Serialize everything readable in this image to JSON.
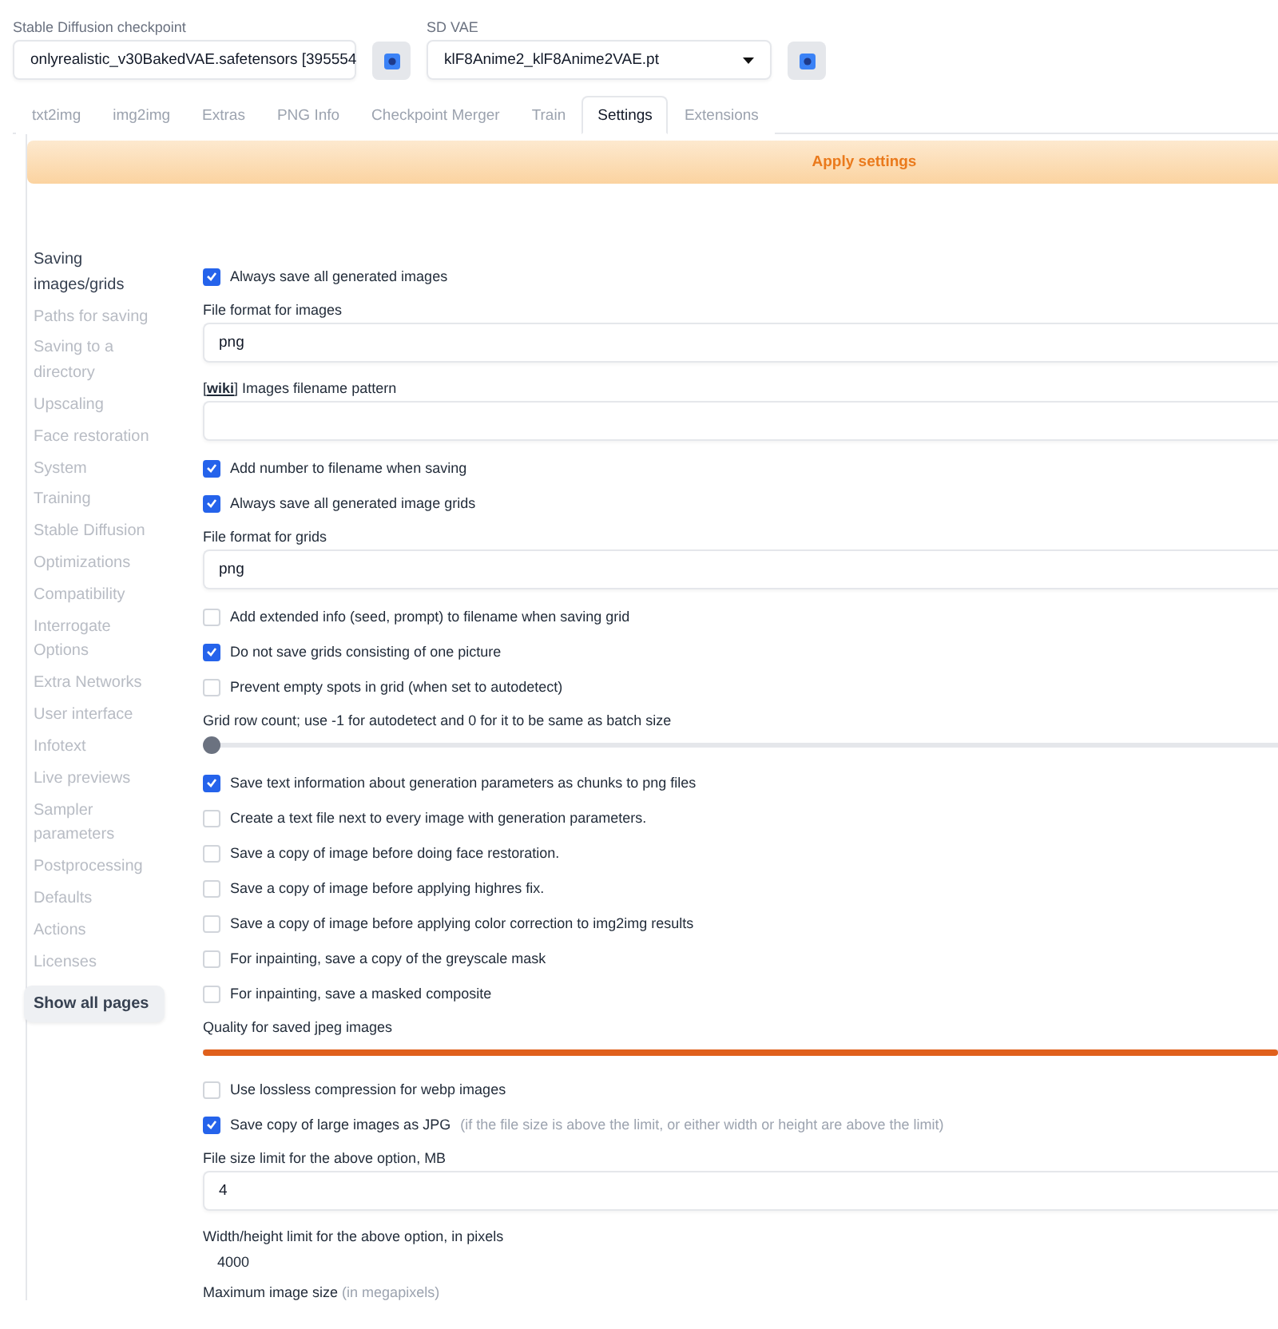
{
  "checkpoint": {
    "label": "Stable Diffusion checkpoint",
    "value": "onlyrealistic_v30BakedVAE.safetensors [395554"
  },
  "vae": {
    "label": "SD VAE",
    "value": "klF8Anime2_klF8Anime2VAE.pt"
  },
  "tabs": [
    {
      "label": "txt2img",
      "selected": false
    },
    {
      "label": "img2img",
      "selected": false
    },
    {
      "label": "Extras",
      "selected": false
    },
    {
      "label": "PNG Info",
      "selected": false
    },
    {
      "label": "Checkpoint Merger",
      "selected": false
    },
    {
      "label": "Train",
      "selected": false
    },
    {
      "label": "Settings",
      "selected": true
    },
    {
      "label": "Extensions",
      "selected": false
    }
  ],
  "apply_button": "Apply settings",
  "sidebar": {
    "items": [
      {
        "label": "Saving images/grids",
        "selected": true
      },
      {
        "label": "Paths for saving",
        "selected": false
      },
      {
        "label": "Saving to a directory",
        "selected": false
      },
      {
        "label": "Upscaling",
        "selected": false
      },
      {
        "label": "Face restoration",
        "selected": false
      },
      {
        "label": "System",
        "selected": false
      },
      {
        "label": "Training",
        "selected": false
      },
      {
        "label": "Stable Diffusion",
        "selected": false
      },
      {
        "label": "Optimizations",
        "selected": false
      },
      {
        "label": "Compatibility",
        "selected": false
      },
      {
        "label": "Interrogate Options",
        "selected": false
      },
      {
        "label": "Extra Networks",
        "selected": false
      },
      {
        "label": "User interface",
        "selected": false
      },
      {
        "label": "Infotext",
        "selected": false
      },
      {
        "label": "Live previews",
        "selected": false
      },
      {
        "label": "Sampler parameters",
        "selected": false
      },
      {
        "label": "Postprocessing",
        "selected": false
      },
      {
        "label": "Defaults",
        "selected": false
      },
      {
        "label": "Actions",
        "selected": false
      },
      {
        "label": "Licenses",
        "selected": false
      }
    ],
    "show_all": "Show all pages"
  },
  "settings": [
    {
      "kind": "checkbox",
      "label": "Always save all generated images",
      "checked": true
    },
    {
      "kind": "text",
      "label": "File format for images",
      "value": "png"
    },
    {
      "kind": "text",
      "label_prefix": "[",
      "link": "wiki",
      "label": "] Images filename pattern"
    },
    {
      "kind": "checkbox",
      "label": "Add number to filename when saving",
      "checked": true
    },
    {
      "kind": "checkbox",
      "label": "Always save all generated image grids",
      "checked": true
    },
    {
      "kind": "text",
      "label": "File format for grids",
      "value": "png"
    },
    {
      "kind": "checkbox",
      "label": "Add extended info (seed, prompt) to filename when saving grid",
      "checked": false
    },
    {
      "kind": "checkbox",
      "label": "Do not save grids consisting of one picture",
      "checked": true
    },
    {
      "kind": "checkbox",
      "label": "Prevent empty spots in grid (when set to autodetect)",
      "checked": false
    },
    {
      "kind": "slider",
      "label": "Grid row count; use -1 for autodetect and 0 for it to be same as batch size",
      "level": 0
    },
    {
      "kind": "checkbox",
      "label": "Save text information about generation parameters as chunks to png files",
      "checked": true
    },
    {
      "kind": "checkbox",
      "label": "Create a text file next to every image with generation parameters.",
      "checked": false
    },
    {
      "kind": "checkbox",
      "label": "Save a copy of image before doing face restoration.",
      "checked": false
    },
    {
      "kind": "checkbox",
      "label": "Save a copy of image before applying highres fix.",
      "checked": false
    },
    {
      "kind": "checkbox",
      "label": "Save a copy of image before applying color correction to img2img results",
      "checked": false
    },
    {
      "kind": "checkbox",
      "label": "For inpainting, save a copy of the greyscale mask",
      "checked": false
    },
    {
      "kind": "checkbox",
      "label": "For inpainting, save a masked composite",
      "checked": false
    },
    {
      "kind": "slider",
      "label": "Quality for saved jpeg images",
      "level": 1
    },
    {
      "kind": "checkbox",
      "label": "Use lossless compression for webp images",
      "checked": false
    },
    {
      "kind": "checkbox",
      "label": "Save copy of large images as JPG",
      "note": "(if the file size is above the limit, or either width or height are above the limit)",
      "checked": true
    },
    {
      "kind": "text",
      "label": "File size limit for the above option, MB",
      "value": "4"
    },
    {
      "kind": "plain",
      "label": "Width/height limit for the above option, in pixels",
      "value": "4000"
    },
    {
      "kind": "heading",
      "label": "Maximum image size",
      "note": "(in megapixels)"
    }
  ]
}
